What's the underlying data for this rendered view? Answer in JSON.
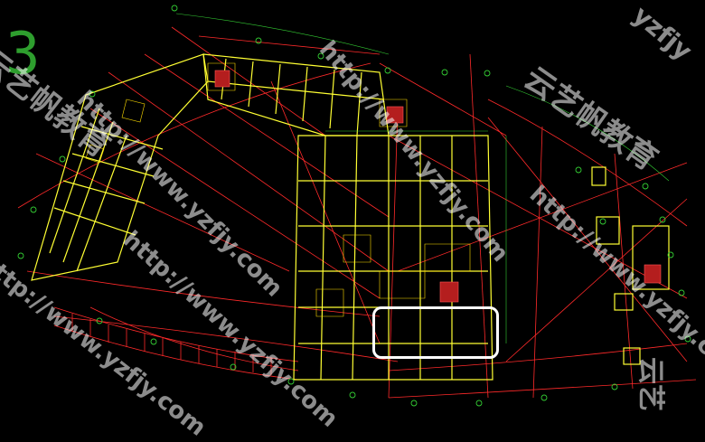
{
  "sheet_number": "3",
  "watermarks": {
    "url": "http://www.yzfjy.com",
    "brand": "云艺帆教育",
    "corner": "yzfjy",
    "edge": "云艺"
  },
  "colors": {
    "background": "#000000",
    "walls": "#ffff33",
    "grid": "#ff2a2a",
    "dims": "#33cc33",
    "stairs": "#cc2222",
    "highlight": "#ffffff"
  }
}
